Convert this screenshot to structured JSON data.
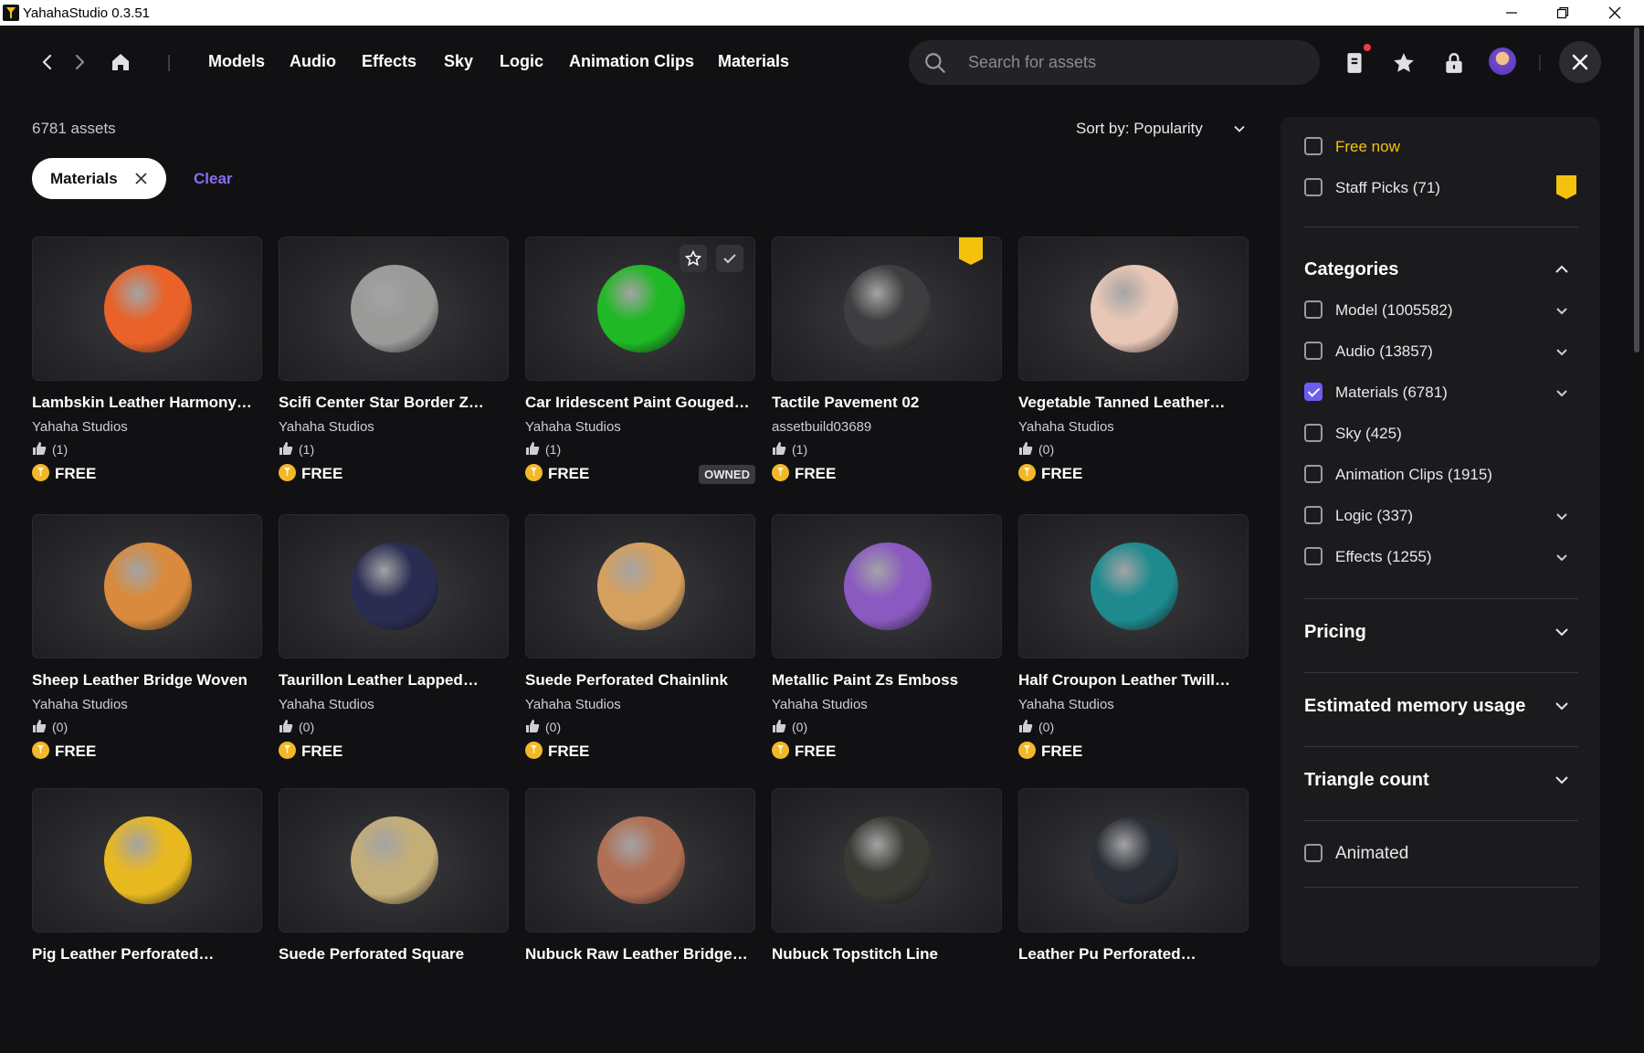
{
  "window": {
    "title": "YahahaStudio 0.3.51"
  },
  "nav": {
    "links": [
      "Models",
      "Audio",
      "Effects",
      "Sky",
      "Logic",
      "Animation Clips",
      "Materials"
    ]
  },
  "search": {
    "placeholder": "Search for assets"
  },
  "results": {
    "count": "6781 assets",
    "sort": "Sort by: Popularity"
  },
  "filters": {
    "chip": "Materials",
    "clear": "Clear"
  },
  "assets": [
    {
      "name": "Lambskin Leather Harmony…",
      "author": "Yahaha Studios",
      "likes": "(1)",
      "price": "FREE",
      "color": "#e8622a"
    },
    {
      "name": "Scifi Center Star Border Z…",
      "author": "Yahaha Studios",
      "likes": "(1)",
      "price": "FREE",
      "color": "#9a9a98"
    },
    {
      "name": "Car Iridescent Paint Gouged…",
      "author": "Yahaha Studios",
      "likes": "(1)",
      "price": "FREE",
      "color": "#20b824",
      "owned": "OWNED"
    },
    {
      "name": "Tactile Pavement 02",
      "author": "assetbuild03689",
      "likes": "(1)",
      "price": "FREE",
      "color": "#3e3e40"
    },
    {
      "name": "Vegetable Tanned Leather…",
      "author": "Yahaha Studios",
      "likes": "(0)",
      "price": "FREE",
      "color": "#e9c7b6"
    },
    {
      "name": "Sheep Leather Bridge Woven",
      "author": "Yahaha Studios",
      "likes": "(0)",
      "price": "FREE",
      "color": "#d98a3c"
    },
    {
      "name": "Taurillon Leather Lapped…",
      "author": "Yahaha Studios",
      "likes": "(0)",
      "price": "FREE",
      "color": "#2a2d52"
    },
    {
      "name": "Suede Perforated Chainlink",
      "author": "Yahaha Studios",
      "likes": "(0)",
      "price": "FREE",
      "color": "#d6a05e"
    },
    {
      "name": "Metallic Paint Zs Emboss",
      "author": "Yahaha Studios",
      "likes": "(0)",
      "price": "FREE",
      "color": "#8a5ac0"
    },
    {
      "name": "Half Croupon Leather Twill…",
      "author": "Yahaha Studios",
      "likes": "(0)",
      "price": "FREE",
      "color": "#1e8a8e"
    },
    {
      "name": "Pig Leather Perforated…",
      "color": "#e8b820"
    },
    {
      "name": "Suede Perforated Square",
      "color": "#c4ae78"
    },
    {
      "name": "Nubuck Raw Leather Bridge…",
      "color": "#b06e52"
    },
    {
      "name": "Nubuck Topstitch Line",
      "color": "#3a3a34"
    },
    {
      "name": "Leather Pu Perforated…",
      "color": "#2a2e36"
    }
  ],
  "panel": {
    "free_now": "Free now",
    "staff_picks": "Staff Picks (71)",
    "categories_title": "Categories",
    "categories": [
      {
        "label": "Model (1005582)",
        "checked": false
      },
      {
        "label": "Audio (13857)",
        "checked": false
      },
      {
        "label": "Materials (6781)",
        "checked": true
      },
      {
        "label": "Sky (425)",
        "checked": false
      },
      {
        "label": "Animation Clips (1915)",
        "checked": false
      },
      {
        "label": "Logic (337)",
        "checked": false
      },
      {
        "label": "Effects (1255)",
        "checked": false
      }
    ],
    "pricing": "Pricing",
    "memory": "Estimated memory usage",
    "triangles": "Triangle count",
    "animated": "Animated"
  },
  "colors": {
    "accent": "#8b6cf5",
    "gold": "#f4c20d",
    "free_now": "#f4c20d"
  }
}
